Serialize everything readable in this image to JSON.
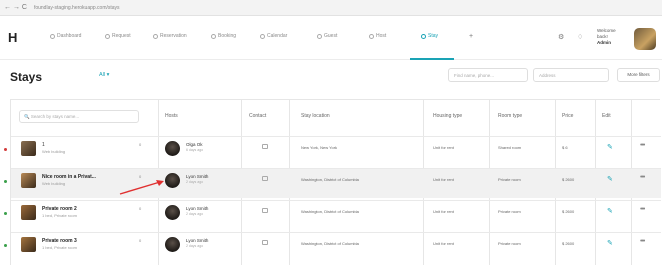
{
  "browser": {
    "nav": "← → C",
    "url": "foundlay-staging.herokuapp.com/stays"
  },
  "app": {
    "logo": "H",
    "tabs": [
      {
        "label": "Dashboard",
        "icon": "dashboard-icon",
        "active": false
      },
      {
        "label": "Request",
        "icon": "request-icon",
        "active": false
      },
      {
        "label": "Reservation",
        "icon": "reservation-icon",
        "active": false
      },
      {
        "label": "Booking",
        "icon": "booking-icon",
        "active": false
      },
      {
        "label": "Calendar",
        "icon": "calendar-icon",
        "active": false
      },
      {
        "label": "Guest",
        "icon": "guest-icon",
        "active": false
      },
      {
        "label": "Host",
        "icon": "host-icon",
        "active": false
      },
      {
        "label": "Stay",
        "icon": "stay-icon",
        "active": true
      }
    ],
    "add": "+",
    "welcome": [
      "Welcome",
      "back!",
      "Admin"
    ]
  },
  "page": {
    "title": "Stays",
    "filter": "All ▾",
    "search_host_placeholder": "Find name, phone...",
    "address_placeholder": "Address",
    "more_filters": "More filters"
  },
  "table": {
    "search_placeholder": "Search by stays name...",
    "columns": [
      "Hosts",
      "Contact",
      "Stay location",
      "Housing type",
      "Room type",
      "Price",
      "Edit"
    ],
    "rows": [
      {
        "dot": "#d23a3a",
        "thumb": "#8a7052",
        "name": "1",
        "sub": "Web building",
        "count": "0",
        "bold": false,
        "highlight": false,
        "host": "Olga Ok",
        "host_sub": "6 days ago",
        "location": "New York, New York",
        "housing": "Unit for rent",
        "room": "Shared room",
        "price": "$ 6"
      },
      {
        "dot": "#3aa04a",
        "thumb": "#b98a56",
        "name": "Nice room in a Privat...",
        "sub": "Web building",
        "count": "0",
        "bold": true,
        "highlight": true,
        "host": "Lyon Smith",
        "host_sub": "2 days ago",
        "location": "Washington, District of Columbia",
        "housing": "Unit for rent",
        "room": "Private room",
        "price": "$ 2600"
      },
      {
        "dot": "#3aa04a",
        "thumb": "#9b6a3a",
        "name": "Private room 2",
        "sub": "1 bed, Private room",
        "count": "0",
        "bold": true,
        "highlight": false,
        "host": "Lyon Smith",
        "host_sub": "2 days ago",
        "location": "Washington, District of Columbia",
        "housing": "Unit for rent",
        "room": "Private room",
        "price": "$ 2600"
      },
      {
        "dot": "#3aa04a",
        "thumb": "#a5743e",
        "name": "Private room 3",
        "sub": "1 bed, Private room",
        "count": "0",
        "bold": true,
        "highlight": false,
        "host": "Lyon Smith",
        "host_sub": "2 days ago",
        "location": "Washington, District of Columbia",
        "housing": "Unit for rent",
        "room": "Private room",
        "price": "$ 2600"
      }
    ],
    "edit_glyph": "✎",
    "more_glyph": "•••"
  },
  "annotation": {
    "arrow_color": "#e03030"
  }
}
